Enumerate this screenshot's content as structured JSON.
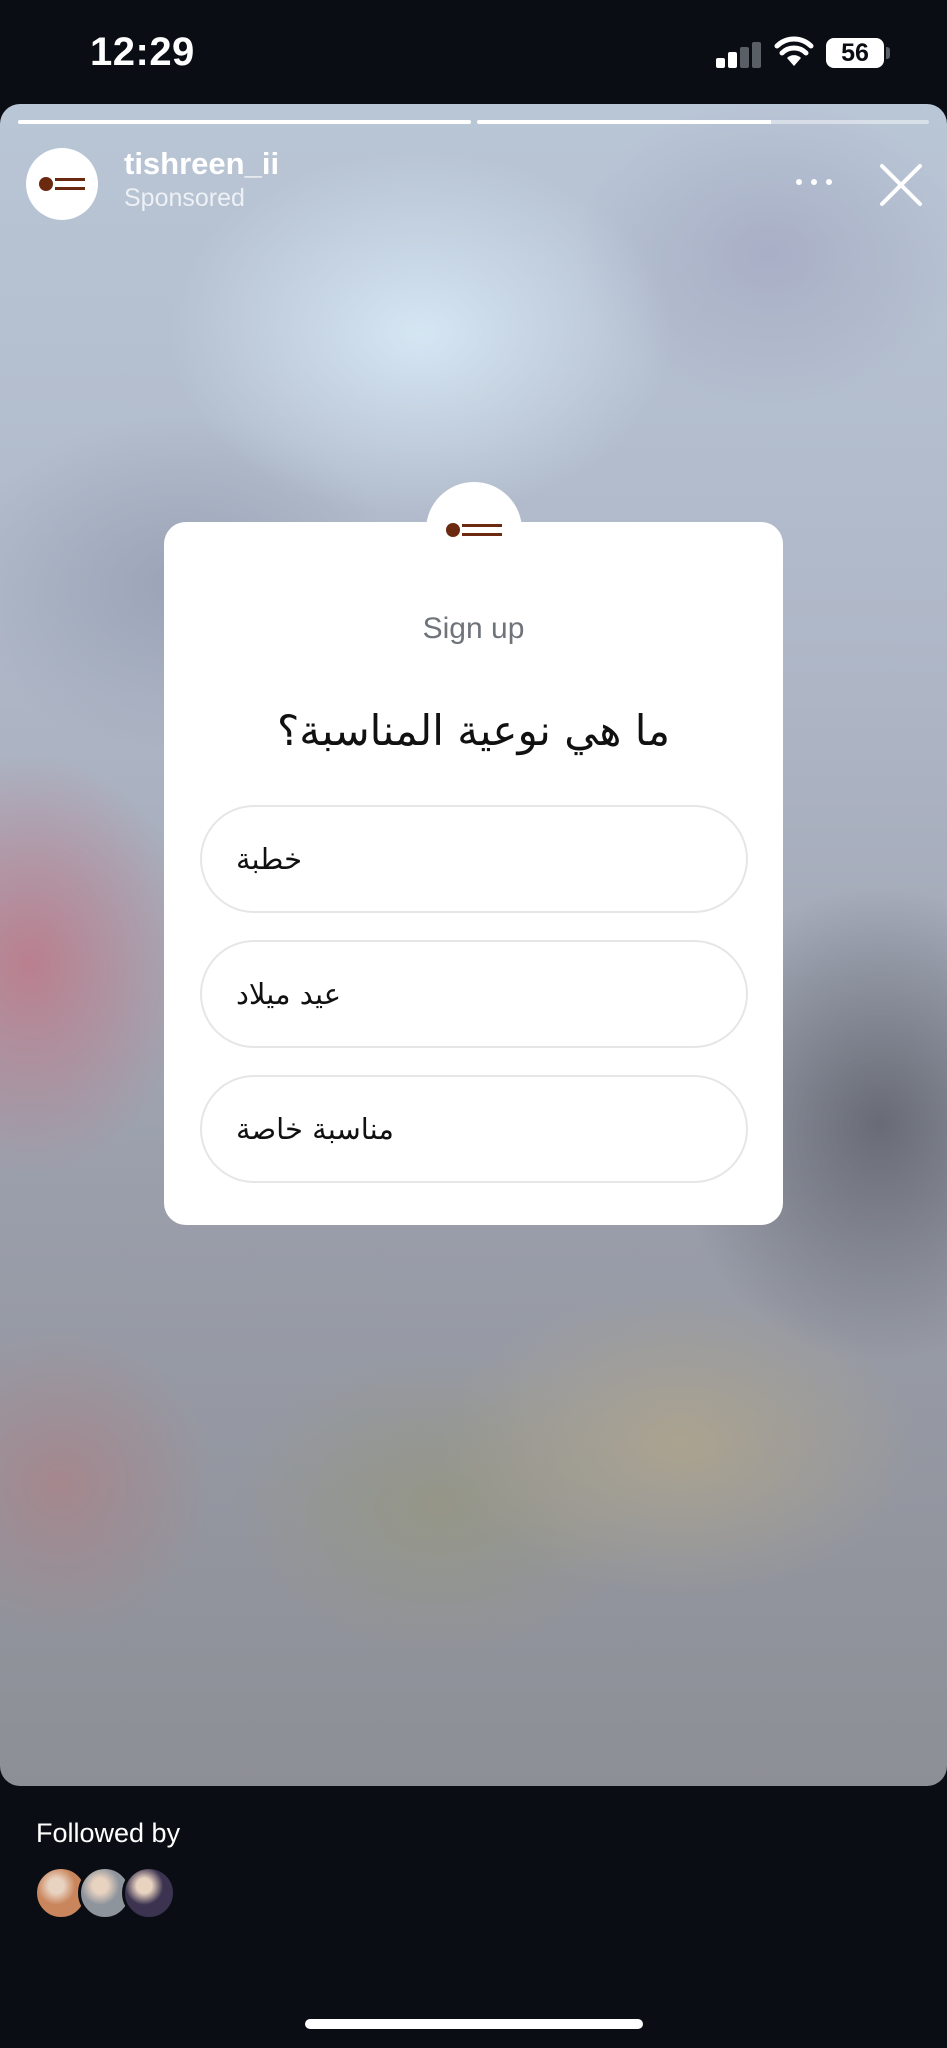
{
  "status_bar": {
    "time": "12:29",
    "battery": "56"
  },
  "story": {
    "progress_segments": [
      1.0,
      0.65
    ],
    "username": "tishreen_ii",
    "sponsored_label": "Sponsored",
    "more_icon": "more-horizontal-icon",
    "close_icon": "close-icon"
  },
  "poll": {
    "title": "Sign up",
    "question": "ما هي نوعية المناسبة؟",
    "options": [
      "خطبة",
      "عيد ميلاد",
      "مناسبة خاصة"
    ]
  },
  "footer": {
    "followed_by_label": "Followed by",
    "follower_avatar_colors": [
      "#c9855c",
      "#8e949c",
      "#3b3350"
    ]
  },
  "colors": {
    "brand": "#6b2a10",
    "background": "#0a0e14"
  }
}
